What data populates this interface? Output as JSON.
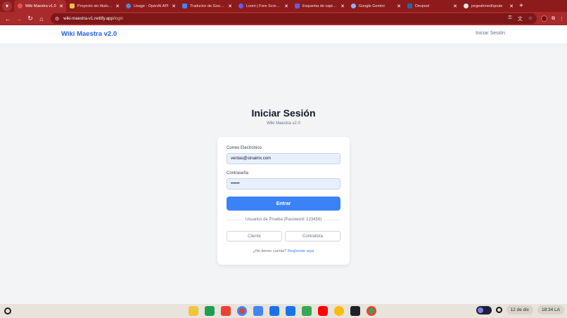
{
  "browser": {
    "tabs": [
      {
        "title": "Wiki Maestra v1.0",
        "color": "#9c2c2c",
        "active": true
      },
      {
        "title": "Proyecto sin título - E",
        "color": "#e8c34a"
      },
      {
        "title": "Usage - OpenAI API",
        "color": "#1f1f1f"
      },
      {
        "title": "Traductor de Google",
        "color": "#4285f4"
      },
      {
        "title": "Loom | Free Screen &",
        "color": "#625df5"
      },
      {
        "title": "Esquema de captura",
        "color": "#6b5bd6"
      },
      {
        "title": "Google Gemini",
        "color": "#8ab4f8"
      },
      {
        "title": "Devpost",
        "color": "#003e54"
      },
      {
        "title": "jorgeahmed/qoute",
        "color": "#24292f"
      }
    ],
    "new_tab": "+",
    "url_host": "wiki-maestra-v1.netlify.app",
    "url_path": "/login"
  },
  "site": {
    "brand": "Wiki Maestra v2.0",
    "nav_login": "Iniciar Sesión"
  },
  "login": {
    "title": "Iniciar Sesión",
    "subtitle": "Wiki Maestra v2.0",
    "email_label": "Correo Electrónico",
    "email_value": "ventas@sinaimx.com",
    "password_label": "Contraseña",
    "password_value": "••••••",
    "submit_label": "Entrar",
    "test_users_label": "Usuarios de Prueba (Password: 123456)",
    "client_button": "Cliente",
    "contractor_button": "Contratista",
    "signup_prompt": "¿No tienes cuenta?",
    "signup_link": "Regístrate aquí"
  },
  "shelf": {
    "date": "12 de dic",
    "time": "18:34",
    "locale": "LA"
  }
}
